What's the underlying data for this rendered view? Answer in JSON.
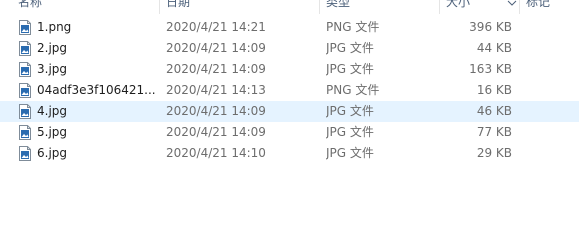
{
  "columns": {
    "name": "名称",
    "date": "日期",
    "type": "类型",
    "size": "大小",
    "tags": "标记"
  },
  "files": [
    {
      "name": "1.png",
      "date": "2020/4/21 14:21",
      "type": "PNG 文件",
      "size": "396 KB",
      "icon": "image-file-icon"
    },
    {
      "name": "2.jpg",
      "date": "2020/4/21 14:09",
      "type": "JPG 文件",
      "size": "44 KB",
      "icon": "image-file-icon"
    },
    {
      "name": "3.jpg",
      "date": "2020/4/21 14:09",
      "type": "JPG 文件",
      "size": "163 KB",
      "icon": "image-file-icon"
    },
    {
      "name": "04adf3e3f106421...",
      "date": "2020/4/21 14:13",
      "type": "PNG 文件",
      "size": "16 KB",
      "icon": "image-file-icon"
    },
    {
      "name": "4.jpg",
      "date": "2020/4/21 14:09",
      "type": "JPG 文件",
      "size": "46 KB",
      "icon": "image-file-icon",
      "selected": true
    },
    {
      "name": "5.jpg",
      "date": "2020/4/21 14:09",
      "type": "JPG 文件",
      "size": "77 KB",
      "icon": "image-file-icon"
    },
    {
      "name": "6.jpg",
      "date": "2020/4/21 14:10",
      "type": "JPG 文件",
      "size": "29 KB",
      "icon": "image-file-icon"
    }
  ],
  "colors": {
    "selection": "#e5f3ff",
    "header_text": "#4c607a",
    "icon_accent": "#2b6cb0"
  }
}
